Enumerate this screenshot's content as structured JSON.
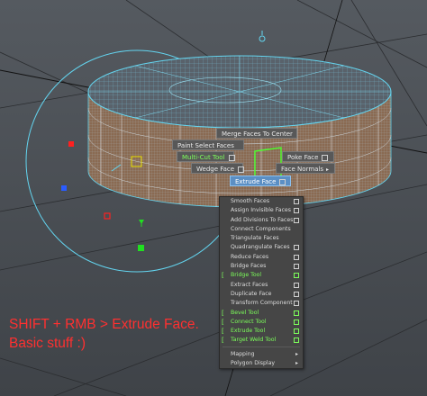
{
  "hotbox": {
    "merge_faces_to_center": "Merge Faces To Center",
    "paint_select_faces": "Paint Select Faces",
    "multi_cut_tool": "Multi-Cut Tool",
    "poke_face": "Poke Face",
    "wedge_face": "Wedge Face",
    "face_normals": "Face Normals",
    "extrude_face": "Extrude Face"
  },
  "menu": {
    "items": [
      {
        "label": "Smooth Faces",
        "option": true
      },
      {
        "label": "Assign Invisible Faces",
        "option": true
      },
      {
        "label": "Add Divisions To Faces",
        "option": true
      },
      {
        "label": "Connect Components",
        "option": false
      },
      {
        "label": "Triangulate Faces",
        "option": false
      },
      {
        "label": "Quadrangulate Faces",
        "option": true
      },
      {
        "label": "Reduce Faces",
        "option": true
      },
      {
        "label": "Bridge Faces",
        "option": true
      },
      {
        "label": "Bridge Tool",
        "option": true,
        "tool": true
      },
      {
        "label": "Extract Faces",
        "option": true
      },
      {
        "label": "Duplicate Face",
        "option": true
      },
      {
        "label": "Transform Component",
        "option": true
      },
      {
        "label": "Bevel Tool",
        "option": true,
        "tool": true
      },
      {
        "label": "Connect Tool",
        "option": true,
        "tool": true
      },
      {
        "label": "Extrude Tool",
        "option": true,
        "tool": true
      },
      {
        "label": "Target Weld Tool",
        "option": true,
        "tool": true
      },
      {
        "label": "Mapping",
        "submenu": true
      },
      {
        "label": "Polygon Display",
        "submenu": true
      }
    ]
  },
  "caption": {
    "line1": "SHIFT + RMB > Extrude Face.",
    "line2": "Basic stuff :)"
  },
  "colors": {
    "viewport_bg": "#4a4e53",
    "wireframe": "#63d5f0",
    "face_fill": "#8a6a52",
    "selection_green": "#4cff2e",
    "caption_red": "#ff3030"
  }
}
